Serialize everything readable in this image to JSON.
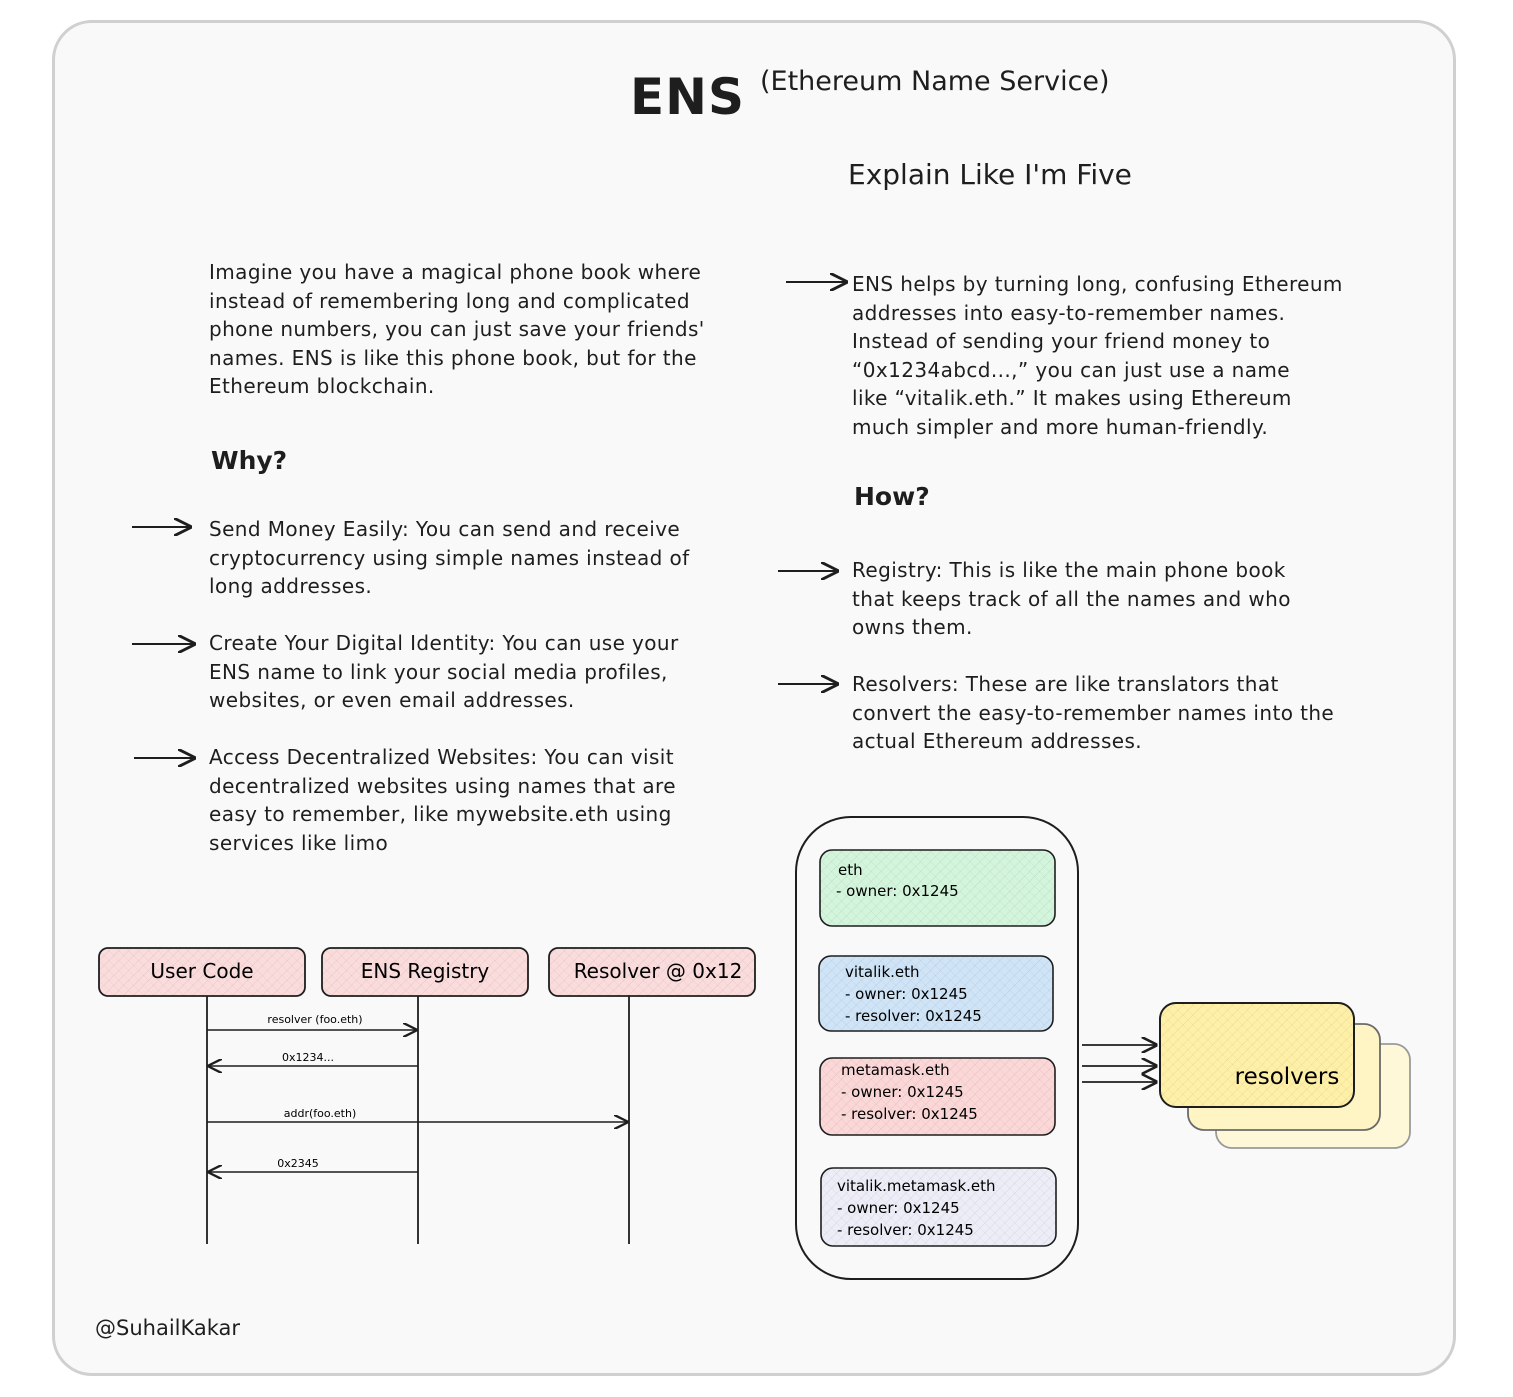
{
  "title": "ENS",
  "subtitle": "(Ethereum Name Service)",
  "eli5_heading": "Explain Like I'm Five",
  "intro": [
    "Imagine you have a magical phone book where",
    "instead of remembering long and complicated",
    "phone numbers, you can just save your friends'",
    "names. ENS is like this phone book, but for the",
    "Ethereum blockchain."
  ],
  "explain": [
    "ENS helps by turning long, confusing Ethereum",
    "addresses into easy-to-remember names.",
    "Instead of sending your friend money to",
    "“0x1234abcd...,” you can just use a name",
    "like “vitalik.eth.” It makes using Ethereum",
    "much simpler and more human-friendly."
  ],
  "why": {
    "heading": "Why?",
    "items": [
      [
        "Send Money Easily: You can send and receive",
        "cryptocurrency using simple names instead of",
        "long addresses."
      ],
      [
        "Create Your Digital Identity: You can use your",
        "ENS name to link your social media profiles,",
        "websites, or even email addresses."
      ],
      [
        "Access Decentralized Websites: You can visit",
        "decentralized websites using names that are",
        "easy to remember, like mywebsite.eth using",
        "services like limo"
      ]
    ]
  },
  "how": {
    "heading": "How?",
    "items": [
      [
        "Registry: This is like the main phone book",
        "that keeps track of all the names and who",
        "owns them."
      ],
      [
        "Resolvers: These are like translators that",
        "convert the easy-to-remember names into the",
        "actual Ethereum addresses."
      ]
    ]
  },
  "sequence": {
    "actors": [
      "User Code",
      "ENS Registry",
      "Resolver @ 0x12"
    ],
    "messages": [
      "resolver (foo.eth)",
      "0x1234...",
      "addr(foo.eth)",
      "0x2345"
    ]
  },
  "registry_entries": [
    {
      "name": "eth",
      "lines": [
        "- owner: 0x1245"
      ],
      "color": "#d3f5dc"
    },
    {
      "name": "vitalik.eth",
      "lines": [
        "- owner: 0x1245",
        "- resolver: 0x1245"
      ],
      "color": "#cfe4f7"
    },
    {
      "name": "metamask.eth",
      "lines": [
        "- owner: 0x1245",
        "- resolver: 0x1245"
      ],
      "color": "#fbd7d7"
    },
    {
      "name": "vitalik.metamask.eth",
      "lines": [
        "- owner: 0x1245",
        "- resolver: 0x1245"
      ],
      "color": "#ededf8"
    }
  ],
  "resolvers_label": "resolvers",
  "colors": {
    "actor_fill": "#fbdcdc",
    "resolver_fill": "#fff3b8",
    "stroke": "#1e1e1e"
  },
  "footer": "@SuhailKakar"
}
